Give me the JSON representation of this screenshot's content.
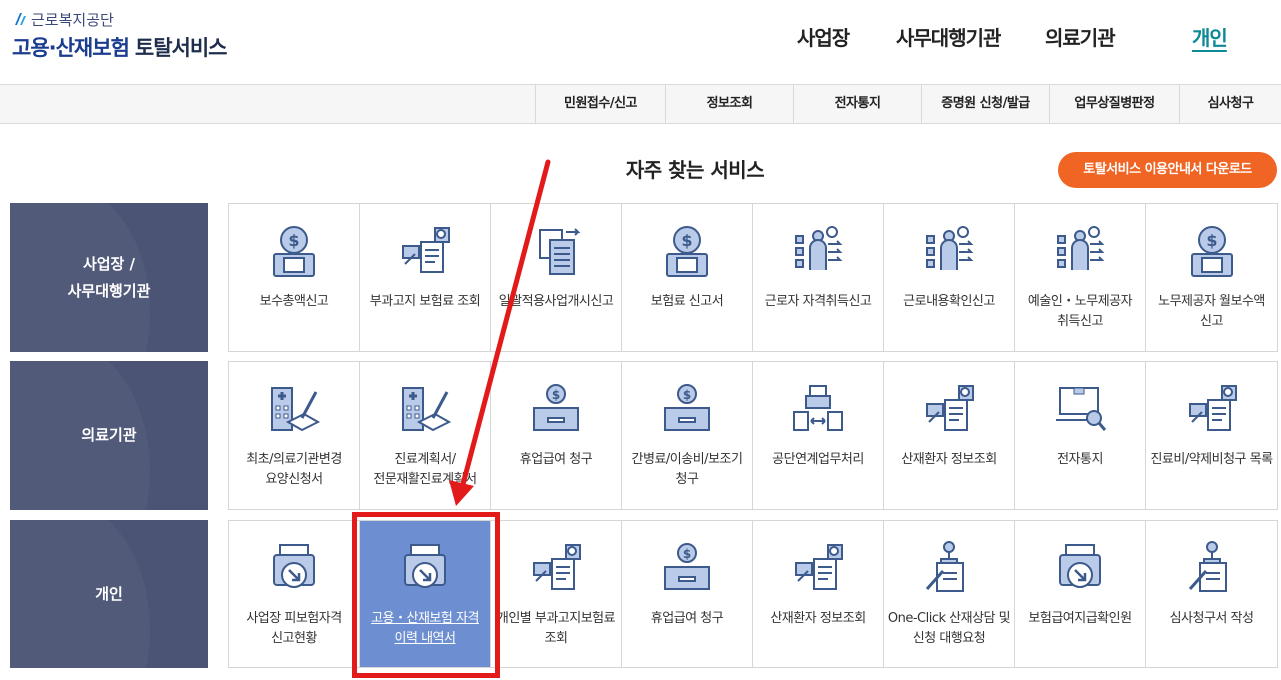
{
  "logo": {
    "org": "근로복지공단",
    "title_main": "고용·산재보험",
    "title_sub": "토탈서비스"
  },
  "topnav": [
    "사업장",
    "사무대행기관",
    "의료기관",
    "개인"
  ],
  "topnav_active": "개인",
  "submenu": [
    "민원접수/신고",
    "정보조회",
    "전자통지",
    "증명원 신청/발급",
    "업무상질병판정",
    "심사청구"
  ],
  "section_title": "자주 찾는 서비스",
  "download_button": "토탈서비스 이용안내서 다운로드",
  "categories": [
    {
      "label": "사업장 /\n사무대행기관",
      "items": [
        {
          "label": "보수총액신고",
          "icon": "money-document-icon"
        },
        {
          "label": "부과고지 보험료 조회",
          "icon": "search-receipt-icon"
        },
        {
          "label": "일괄적용사업개시신고",
          "icon": "documents-transfer-icon"
        },
        {
          "label": "보험료 신고서",
          "icon": "money-document-icon"
        },
        {
          "label": "근로자 자격취득신고",
          "icon": "presenter-chart-icon"
        },
        {
          "label": "근로내용확인신고",
          "icon": "presenter-chart-icon"
        },
        {
          "label": "예술인・노무제공자 취득신고",
          "icon": "presenter-chart-icon"
        },
        {
          "label": "노무제공자 월보수액 신고",
          "icon": "money-document-icon"
        }
      ]
    },
    {
      "label": "의료기관",
      "items": [
        {
          "label": "최초/의료기관변경 요양신청서",
          "icon": "hospital-writing-icon"
        },
        {
          "label": "진료계획서/전문재활진료계획서",
          "icon": "hospital-writing-icon"
        },
        {
          "label": "휴업급여 청구",
          "icon": "coin-box-icon"
        },
        {
          "label": "간병료/이송비/보조기 청구",
          "icon": "coin-box-icon"
        },
        {
          "label": "공단연계업무처리",
          "icon": "printer-exchange-icon"
        },
        {
          "label": "산재환자 정보조회",
          "icon": "search-receipt-icon"
        },
        {
          "label": "전자통지",
          "icon": "laptop-search-icon"
        },
        {
          "label": "진료비/약제비청구 목록",
          "icon": "search-receipt-icon"
        }
      ]
    },
    {
      "label": "개인",
      "items": [
        {
          "label": "사업장 피보험자격 신고현황",
          "icon": "printer-download-icon"
        },
        {
          "label": "고용・산재보험 자격 이력 내역서",
          "icon": "printer-download-icon",
          "selected": true
        },
        {
          "label": "개인별 부과고지보험료 조회",
          "icon": "search-receipt-icon"
        },
        {
          "label": "휴업급여 청구",
          "icon": "coin-box-icon"
        },
        {
          "label": "산재환자 정보조회",
          "icon": "search-receipt-icon"
        },
        {
          "label": "One-Click 산재상담 및 신청 대행요청",
          "icon": "pin-document-icon"
        },
        {
          "label": "보험급여지급확인원",
          "icon": "printer-download-icon"
        },
        {
          "label": "심사청구서 작성",
          "icon": "pin-document-icon"
        }
      ]
    }
  ],
  "colors": {
    "category_bg": "#4b5475",
    "selected_bg": "#6d8ed0",
    "download_bg": "#f06424",
    "active_nav": "#0e8a96",
    "annotation_red": "#e21a1a",
    "icon_stroke": "#3d5a8c",
    "icon_fill": "#b9cbe8"
  }
}
